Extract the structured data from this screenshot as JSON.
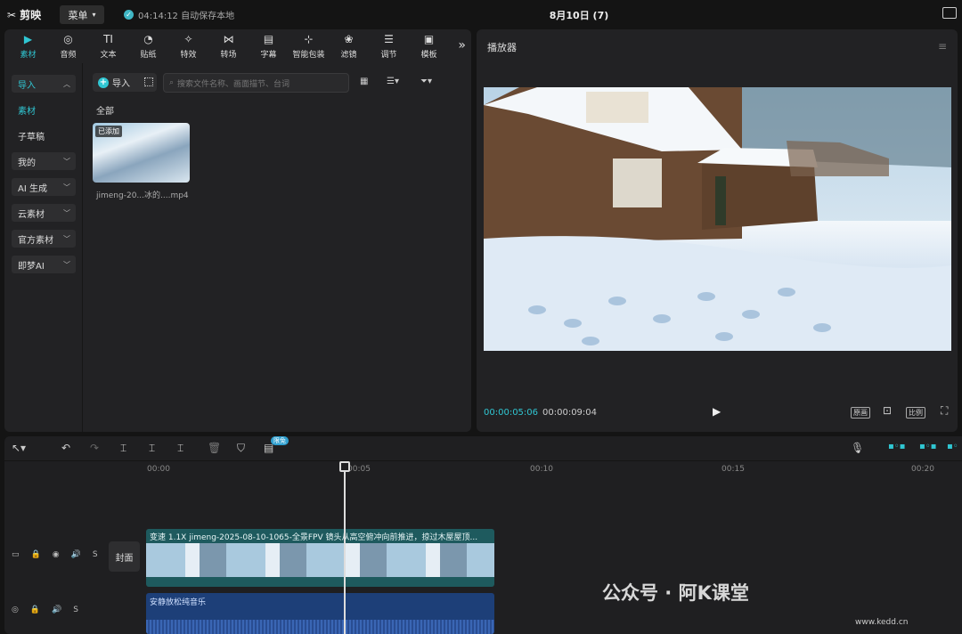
{
  "top": {
    "app_name": "剪映",
    "menu_label": "菜单",
    "autosave": "04:14:12 自动保存本地",
    "project_title": "8月10日 (7)"
  },
  "media": {
    "tabs": [
      {
        "label": "素材",
        "icon": "media-icon"
      },
      {
        "label": "音频",
        "icon": "audio-icon"
      },
      {
        "label": "文本",
        "icon": "text-icon"
      },
      {
        "label": "贴纸",
        "icon": "sticker-icon"
      },
      {
        "label": "特效",
        "icon": "effects-icon"
      },
      {
        "label": "转场",
        "icon": "transition-icon"
      },
      {
        "label": "字幕",
        "icon": "subtitle-icon"
      },
      {
        "label": "智能包装",
        "icon": "smart-pack-icon"
      },
      {
        "label": "滤镜",
        "icon": "filter-icon"
      },
      {
        "label": "调节",
        "icon": "adjust-icon"
      },
      {
        "label": "模板",
        "icon": "template-icon"
      }
    ],
    "sidebar": {
      "import": "导入",
      "material": "素材",
      "sub_draft": "子草稿",
      "mine": "我的",
      "ai_gen": "AI 生成",
      "cloud": "云素材",
      "official": "官方素材",
      "jimeng": "即梦AI"
    },
    "import_button": "导入",
    "search_placeholder": "搜索文件名称、画面描节、台词",
    "section_all": "全部",
    "item_badge": "已添加",
    "item_name": "jimeng-20...冰的....mp4"
  },
  "player": {
    "title": "播放器",
    "current_time": "00:00:05:06",
    "total_time": "00:00:09:04",
    "btn_original": "原画",
    "btn_ratio": "比例"
  },
  "timeline": {
    "ai_badge": "限免",
    "ruler": [
      "00:00",
      "00:05",
      "00:10",
      "00:15",
      "00:20"
    ],
    "cover_label": "封面",
    "video_clip_label": "变速 1.1X  jimeng-2025-08-10-1065-全景FPV 镜头从高空俯冲向前推进，掠过木屋屋顶...",
    "audio_clip_label": "安静放松纯音乐"
  },
  "watermark": {
    "text": "公众号 · 阿K课堂",
    "site": "www.kedd.cn"
  }
}
